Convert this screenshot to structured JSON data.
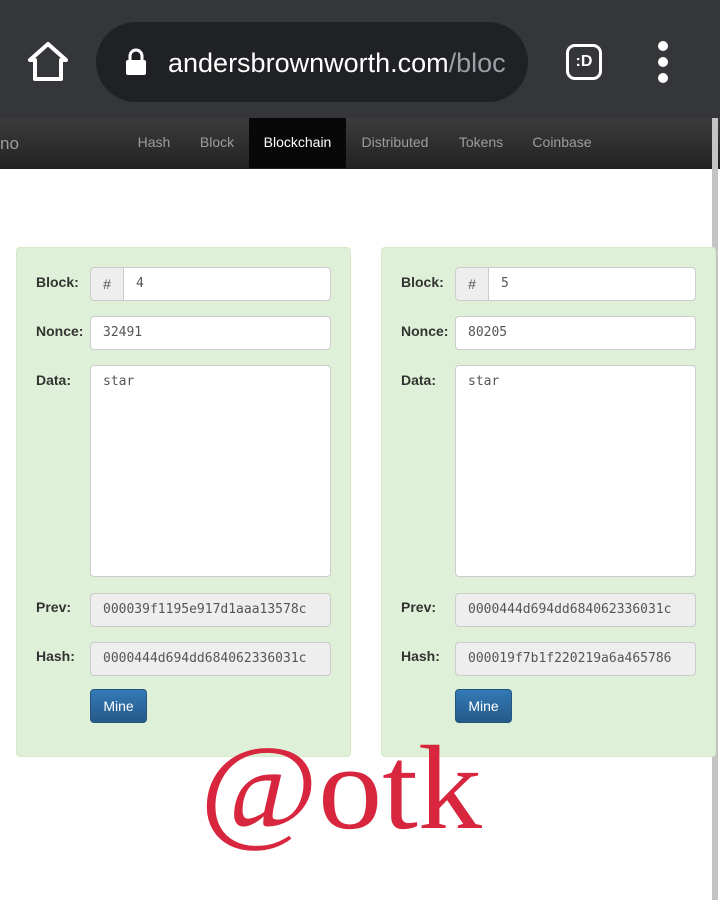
{
  "browser": {
    "url_host": "andersbrownworth.com",
    "url_path": "/bloc",
    "extension_label": ":D",
    "icons": {
      "home": "home-icon",
      "lock": "lock-icon",
      "menu": "more-vert-icon"
    }
  },
  "site": {
    "brand_fragment": "no",
    "nav": [
      {
        "label": "Hash",
        "active": false
      },
      {
        "label": "Block",
        "active": false
      },
      {
        "label": "Blockchain",
        "active": true
      },
      {
        "label": "Distributed",
        "active": false
      },
      {
        "label": "Tokens",
        "active": false
      },
      {
        "label": "Coinbase",
        "active": false
      }
    ]
  },
  "labels": {
    "block": "Block:",
    "nonce": "Nonce:",
    "data": "Data:",
    "prev": "Prev:",
    "hash": "Hash:",
    "hash_sign": "#",
    "mine": "Mine"
  },
  "blocks": [
    {
      "number": "4",
      "nonce": "32491",
      "data": "star",
      "prev": "000039f1195e917d1aaa13578c",
      "hash": "0000444d694dd684062336031c"
    },
    {
      "number": "5",
      "nonce": "80205",
      "data": "star",
      "prev": "0000444d694dd684062336031c",
      "hash": "000019f7b1f220219a6a465786"
    }
  ],
  "watermark": {
    "text": "@otk",
    "color": "#d7263d"
  }
}
